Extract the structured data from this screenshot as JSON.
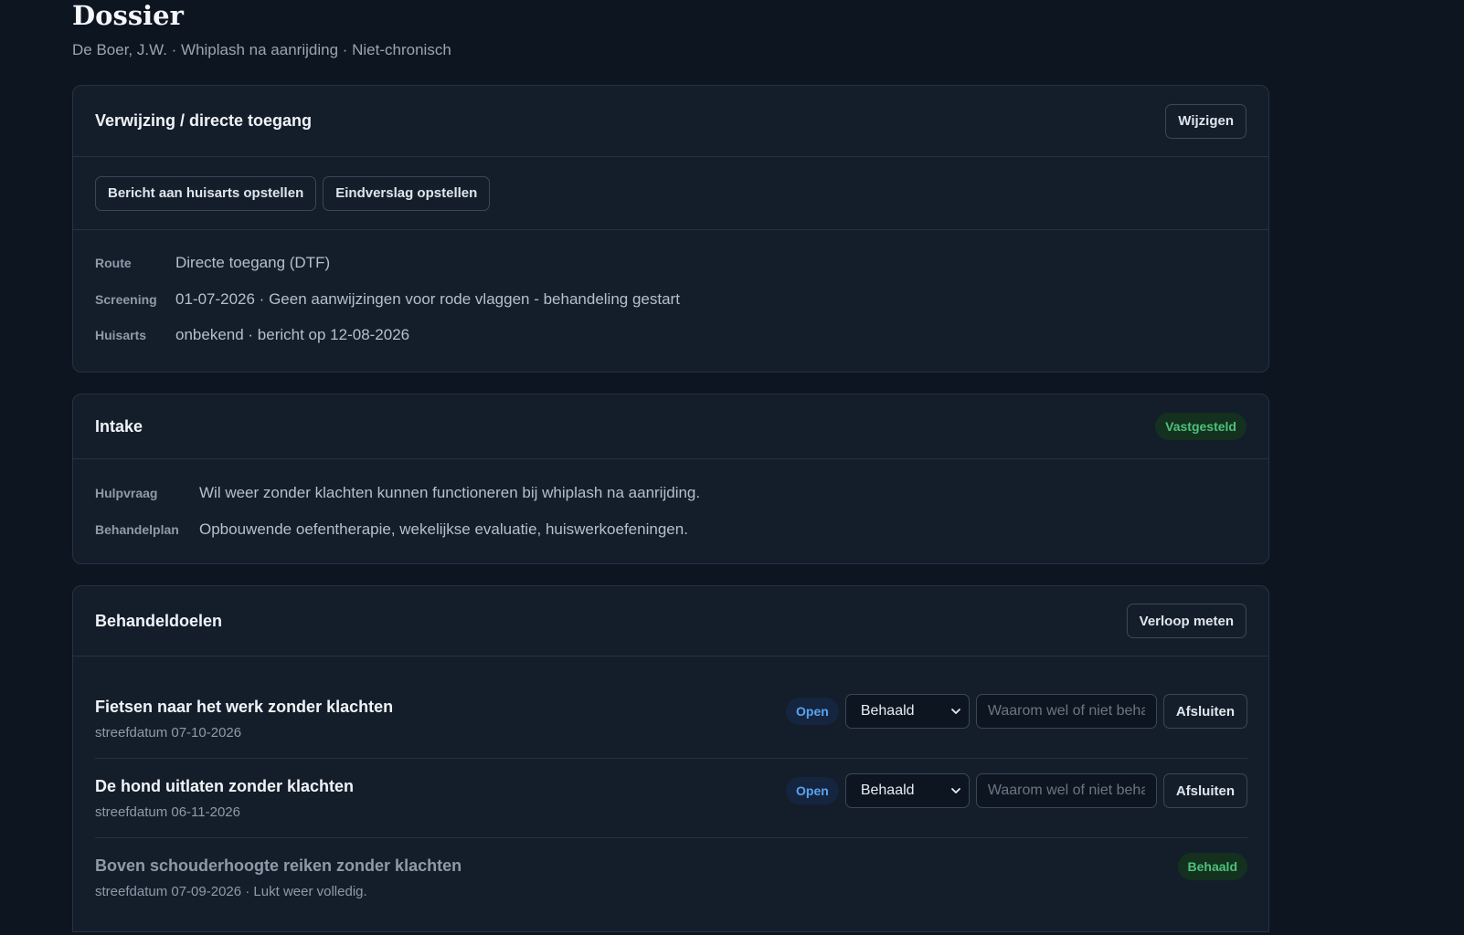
{
  "page": {
    "title": "Dossier",
    "subtitle": "De Boer, J.W. · Whiplash na aanrijding · Niet-chronisch"
  },
  "referral": {
    "title": "Verwijzing / directe toegang",
    "edit_label": "Wijzigen",
    "actions": {
      "gp_message": "Bericht aan huisarts opstellen",
      "final_report": "Eindverslag opstellen"
    },
    "rows": [
      {
        "key": "Route",
        "value": "Directe toegang (DTF)"
      },
      {
        "key": "Screening",
        "value": "01-07-2026 · Geen aanwijzingen voor rode vlaggen - behandeling gestart"
      },
      {
        "key": "Huisarts",
        "value": "onbekend · bericht op 12-08-2026"
      }
    ]
  },
  "intake": {
    "title": "Intake",
    "status": "Vastgesteld",
    "rows": [
      {
        "key": "Hulpvraag",
        "value": "Wil weer zonder klachten kunnen functioneren bij whiplash na aanrijding."
      },
      {
        "key": "Behandelplan",
        "value": "Opbouwende oefentherapie, wekelijkse evaluatie, huiswerkoefeningen."
      }
    ]
  },
  "goals": {
    "title": "Behandeldoelen",
    "measure_label": "Verloop meten",
    "items": [
      {
        "title": "Fietsen naar het werk zonder klachten",
        "subtitle": "streefdatum 07-10-2026",
        "status": "Open",
        "outcome": "Behaald",
        "reason_placeholder": "Waarom wel of niet behaald?",
        "close_label": "Afsluiten"
      },
      {
        "title": "De hond uitlaten zonder klachten",
        "subtitle": "streefdatum 06-11-2026",
        "status": "Open",
        "outcome": "Behaald",
        "reason_placeholder": "Waarom wel of niet behaald?",
        "close_label": "Afsluiten"
      },
      {
        "title": "Boven schouderhoogte reiken zonder klachten",
        "subtitle": "streefdatum 07-09-2026 · Lukt weer volledig.",
        "status": "Behaald"
      }
    ]
  },
  "colors": {
    "background": "#0d1520",
    "card": "#141e2b",
    "accent_green": "#4cc27a",
    "accent_blue": "#5aa3f0"
  }
}
